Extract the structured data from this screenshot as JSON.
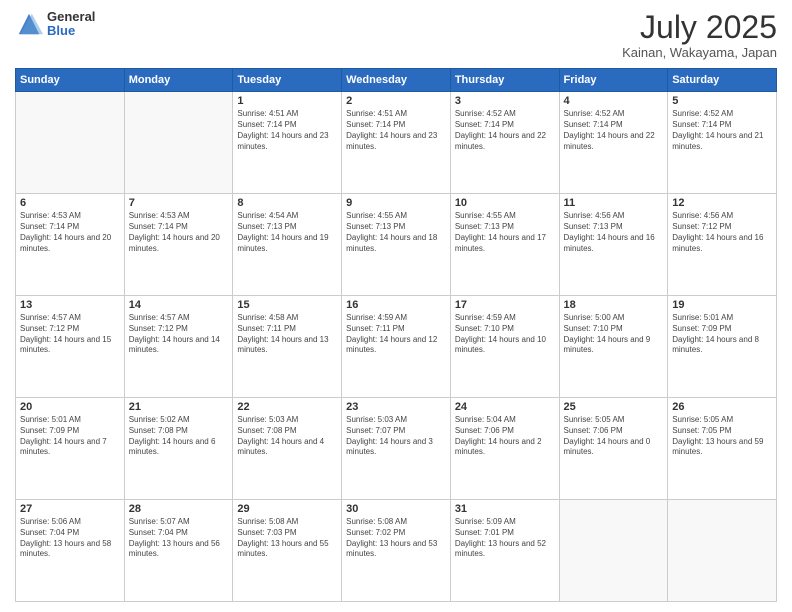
{
  "header": {
    "logo_general": "General",
    "logo_blue": "Blue",
    "title": "July 2025",
    "location": "Kainan, Wakayama, Japan"
  },
  "calendar": {
    "days_of_week": [
      "Sunday",
      "Monday",
      "Tuesday",
      "Wednesday",
      "Thursday",
      "Friday",
      "Saturday"
    ],
    "weeks": [
      [
        {
          "day": "",
          "empty": true
        },
        {
          "day": "",
          "empty": true
        },
        {
          "day": "1",
          "sunrise": "Sunrise: 4:51 AM",
          "sunset": "Sunset: 7:14 PM",
          "daylight": "Daylight: 14 hours and 23 minutes."
        },
        {
          "day": "2",
          "sunrise": "Sunrise: 4:51 AM",
          "sunset": "Sunset: 7:14 PM",
          "daylight": "Daylight: 14 hours and 23 minutes."
        },
        {
          "day": "3",
          "sunrise": "Sunrise: 4:52 AM",
          "sunset": "Sunset: 7:14 PM",
          "daylight": "Daylight: 14 hours and 22 minutes."
        },
        {
          "day": "4",
          "sunrise": "Sunrise: 4:52 AM",
          "sunset": "Sunset: 7:14 PM",
          "daylight": "Daylight: 14 hours and 22 minutes."
        },
        {
          "day": "5",
          "sunrise": "Sunrise: 4:52 AM",
          "sunset": "Sunset: 7:14 PM",
          "daylight": "Daylight: 14 hours and 21 minutes."
        }
      ],
      [
        {
          "day": "6",
          "sunrise": "Sunrise: 4:53 AM",
          "sunset": "Sunset: 7:14 PM",
          "daylight": "Daylight: 14 hours and 20 minutes."
        },
        {
          "day": "7",
          "sunrise": "Sunrise: 4:53 AM",
          "sunset": "Sunset: 7:14 PM",
          "daylight": "Daylight: 14 hours and 20 minutes."
        },
        {
          "day": "8",
          "sunrise": "Sunrise: 4:54 AM",
          "sunset": "Sunset: 7:13 PM",
          "daylight": "Daylight: 14 hours and 19 minutes."
        },
        {
          "day": "9",
          "sunrise": "Sunrise: 4:55 AM",
          "sunset": "Sunset: 7:13 PM",
          "daylight": "Daylight: 14 hours and 18 minutes."
        },
        {
          "day": "10",
          "sunrise": "Sunrise: 4:55 AM",
          "sunset": "Sunset: 7:13 PM",
          "daylight": "Daylight: 14 hours and 17 minutes."
        },
        {
          "day": "11",
          "sunrise": "Sunrise: 4:56 AM",
          "sunset": "Sunset: 7:13 PM",
          "daylight": "Daylight: 14 hours and 16 minutes."
        },
        {
          "day": "12",
          "sunrise": "Sunrise: 4:56 AM",
          "sunset": "Sunset: 7:12 PM",
          "daylight": "Daylight: 14 hours and 16 minutes."
        }
      ],
      [
        {
          "day": "13",
          "sunrise": "Sunrise: 4:57 AM",
          "sunset": "Sunset: 7:12 PM",
          "daylight": "Daylight: 14 hours and 15 minutes."
        },
        {
          "day": "14",
          "sunrise": "Sunrise: 4:57 AM",
          "sunset": "Sunset: 7:12 PM",
          "daylight": "Daylight: 14 hours and 14 minutes."
        },
        {
          "day": "15",
          "sunrise": "Sunrise: 4:58 AM",
          "sunset": "Sunset: 7:11 PM",
          "daylight": "Daylight: 14 hours and 13 minutes."
        },
        {
          "day": "16",
          "sunrise": "Sunrise: 4:59 AM",
          "sunset": "Sunset: 7:11 PM",
          "daylight": "Daylight: 14 hours and 12 minutes."
        },
        {
          "day": "17",
          "sunrise": "Sunrise: 4:59 AM",
          "sunset": "Sunset: 7:10 PM",
          "daylight": "Daylight: 14 hours and 10 minutes."
        },
        {
          "day": "18",
          "sunrise": "Sunrise: 5:00 AM",
          "sunset": "Sunset: 7:10 PM",
          "daylight": "Daylight: 14 hours and 9 minutes."
        },
        {
          "day": "19",
          "sunrise": "Sunrise: 5:01 AM",
          "sunset": "Sunset: 7:09 PM",
          "daylight": "Daylight: 14 hours and 8 minutes."
        }
      ],
      [
        {
          "day": "20",
          "sunrise": "Sunrise: 5:01 AM",
          "sunset": "Sunset: 7:09 PM",
          "daylight": "Daylight: 14 hours and 7 minutes."
        },
        {
          "day": "21",
          "sunrise": "Sunrise: 5:02 AM",
          "sunset": "Sunset: 7:08 PM",
          "daylight": "Daylight: 14 hours and 6 minutes."
        },
        {
          "day": "22",
          "sunrise": "Sunrise: 5:03 AM",
          "sunset": "Sunset: 7:08 PM",
          "daylight": "Daylight: 14 hours and 4 minutes."
        },
        {
          "day": "23",
          "sunrise": "Sunrise: 5:03 AM",
          "sunset": "Sunset: 7:07 PM",
          "daylight": "Daylight: 14 hours and 3 minutes."
        },
        {
          "day": "24",
          "sunrise": "Sunrise: 5:04 AM",
          "sunset": "Sunset: 7:06 PM",
          "daylight": "Daylight: 14 hours and 2 minutes."
        },
        {
          "day": "25",
          "sunrise": "Sunrise: 5:05 AM",
          "sunset": "Sunset: 7:06 PM",
          "daylight": "Daylight: 14 hours and 0 minutes."
        },
        {
          "day": "26",
          "sunrise": "Sunrise: 5:05 AM",
          "sunset": "Sunset: 7:05 PM",
          "daylight": "Daylight: 13 hours and 59 minutes."
        }
      ],
      [
        {
          "day": "27",
          "sunrise": "Sunrise: 5:06 AM",
          "sunset": "Sunset: 7:04 PM",
          "daylight": "Daylight: 13 hours and 58 minutes."
        },
        {
          "day": "28",
          "sunrise": "Sunrise: 5:07 AM",
          "sunset": "Sunset: 7:04 PM",
          "daylight": "Daylight: 13 hours and 56 minutes."
        },
        {
          "day": "29",
          "sunrise": "Sunrise: 5:08 AM",
          "sunset": "Sunset: 7:03 PM",
          "daylight": "Daylight: 13 hours and 55 minutes."
        },
        {
          "day": "30",
          "sunrise": "Sunrise: 5:08 AM",
          "sunset": "Sunset: 7:02 PM",
          "daylight": "Daylight: 13 hours and 53 minutes."
        },
        {
          "day": "31",
          "sunrise": "Sunrise: 5:09 AM",
          "sunset": "Sunset: 7:01 PM",
          "daylight": "Daylight: 13 hours and 52 minutes."
        },
        {
          "day": "",
          "empty": true
        },
        {
          "day": "",
          "empty": true
        }
      ]
    ]
  }
}
